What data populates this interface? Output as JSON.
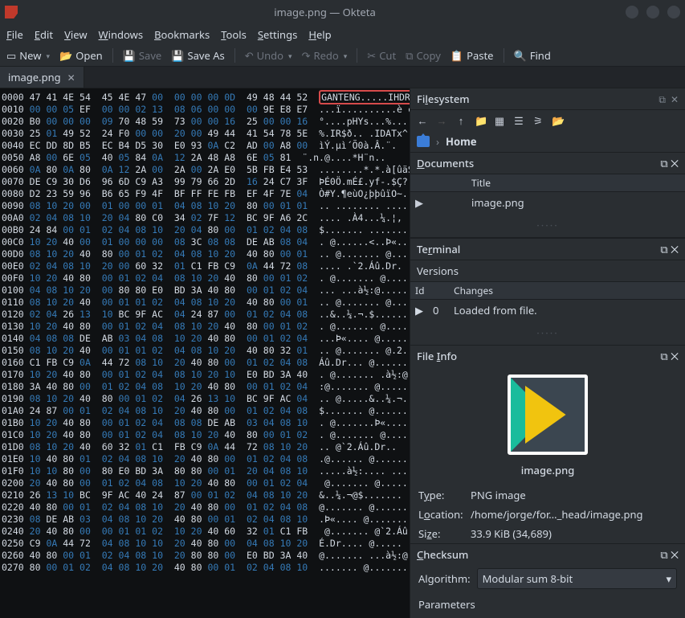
{
  "window": {
    "title": "image.png — Okteta"
  },
  "menu": {
    "file": "File",
    "edit": "Edit",
    "view": "View",
    "windows": "Windows",
    "bookmarks": "Bookmarks",
    "tools": "Tools",
    "settings": "Settings",
    "help": "Help"
  },
  "toolbar": {
    "new": "New",
    "open": "Open",
    "save": "Save",
    "saveas": "Save As",
    "undo": "Undo",
    "redo": "Redo",
    "cut": "Cut",
    "copy": "Copy",
    "paste": "Paste",
    "find": "Find"
  },
  "tab": {
    "name": "image.png"
  },
  "hex": {
    "rows": [
      {
        "off": "0000",
        "hex": "47 41 4E 54  45 4E 47 00  00 00 00 0D  49 48 44 52",
        "asc": "GANTENG.....IHDR",
        "hl": true
      },
      {
        "off": "0010",
        "hex": "00 00 05 EF  00 00 02 13  08 06 00 00  00 9E E8 E7",
        "asc": "...ï..........è ç"
      },
      {
        "off": "0020",
        "hex": "B0 00 00 00  09 70 48 59  73 00 00 16  25 00 00 16",
        "asc": "°....pHYs...%..."
      },
      {
        "off": "0030",
        "hex": "25 01 49 52  24 F0 00 00  20 00 49 44  41 54 78 5E",
        "asc": "%.IR$ð.. .IDATx^"
      },
      {
        "off": "0040",
        "hex": "EC DD 8D B5  EC B4 D5 30  E0 93 0A C2  AD 00 A8 00",
        "asc": "ìÝ.µì´Õ0à.Â­.¨."
      },
      {
        "off": "0050",
        "hex": "A8 00 6E 05  40 05 84 0A  12 2A 48 A8  6E 05 81",
        "asc": "¨.n.@....*H¨n.."
      },
      {
        "off": "0060",
        "hex": "0A 80 0A 80  0A 12 2A 00  2A 00 2A E0  5B FB E4 53",
        "asc": "........*.*.à[ûäS"
      },
      {
        "off": "0070",
        "hex": "DE C9 30 D6  96 6D C9 A3  99 79 66 2D  16 24 C7 3F",
        "asc": "ÞÉ0Ö.mÉ£.yf-.$Ç?"
      },
      {
        "off": "0080",
        "hex": "D2 23 59 96  B6 65 F9 4F  BF FF FE FB  EF 4F 7E 04",
        "asc": "Ò#Y.¶eùO¿þþûïO~."
      },
      {
        "off": "0090",
        "hex": "08 10 20 00  01 00 00 01  04 08 10 20  80 00 01 01",
        "asc": ".. ........ ...."
      },
      {
        "off": "00A0",
        "hex": "02 04 08 10  20 04 80 C0  34 02 7F 12  BC 9F A6 2C",
        "asc": ".... .À4...¼.¦,"
      },
      {
        "off": "00B0",
        "hex": "24 84 00 01  02 04 08 10  20 04 80 00  01 02 04 08",
        "asc": "$....... ......."
      },
      {
        "off": "00C0",
        "hex": "10 20 40 00  01 00 00 00  08 3C 08 08  DE AB 08 04",
        "asc": ". @......<..Þ«.."
      },
      {
        "off": "00D0",
        "hex": "08 10 20 40  80 00 01 02  04 08 10 20  40 80 00 01",
        "asc": ".. @....... @..."
      },
      {
        "off": "00E0",
        "hex": "02 04 08 10  20 00 60 32  01 C1 FB C9  0A 44 72 08",
        "asc": ".... .`2.Áû.Dr."
      },
      {
        "off": "00F0",
        "hex": "10 20 40 80  00 01 02 04  08 10 20 40  80 00 01 02",
        "asc": ". @....... @...."
      },
      {
        "off": "0100",
        "hex": "04 08 10 20  00 80 80 E0  BD 3A 40 80  00 01 02 04",
        "asc": "... ...à½:@....."
      },
      {
        "off": "0110",
        "hex": "08 10 20 40  00 01 01 02  04 08 10 20  40 80 00 01",
        "asc": ".. @....... @..."
      },
      {
        "off": "0120",
        "hex": "02 04 26 13  10 BC 9F AC  04 24 87 00  01 02 04 08",
        "asc": "..&..¼.¬.$......"
      },
      {
        "off": "0130",
        "hex": "10 20 40 80  00 01 02 04  08 10 20 40  80 00 01 02",
        "asc": ". @....... @...."
      },
      {
        "off": "0140",
        "hex": "04 08 08 DE  AB 03 04 08  10 20 40 80  00 01 02 04",
        "asc": "...Þ«.... @....."
      },
      {
        "off": "0150",
        "hex": "08 10 20 40  00 01 01 02  04 08 10 20  40 80 32 01",
        "asc": ".. @....... @.2."
      },
      {
        "off": "0160",
        "hex": "C1 FB C9 0A  44 72 08 10  20 40 80 00  01 02 04 08",
        "asc": "Áû.Dr... @......"
      },
      {
        "off": "0170",
        "hex": "10 20 40 80  00 01 02 04  08 10 20 10  E0 BD 3A 40",
        "asc": ". @....... .à½:@"
      },
      {
        "off": "0180",
        "hex": "3A 40 80 00  01 02 04 08  10 20 40 80  00 01 02 04",
        "asc": ":@....... @....."
      },
      {
        "off": "0190",
        "hex": "08 10 20 40  80 00 01 02  04 26 13 10  BC 9F AC 04",
        "asc": ".. @.....&..¼.¬."
      },
      {
        "off": "01A0",
        "hex": "24 87 00 01  02 04 08 10  20 40 80 00  01 02 04 08",
        "asc": "$....... @......"
      },
      {
        "off": "01B0",
        "hex": "10 20 40 80  00 01 02 04  08 08 DE AB  03 04 08 10",
        "asc": ". @.......Þ«...."
      },
      {
        "off": "01C0",
        "hex": "10 20 40 80  00 01 02 04  08 10 20 40  80 00 01 02",
        "asc": ". @....... @...."
      },
      {
        "off": "01D0",
        "hex": "08 10 20 40  60 32 01 C1  FB C9 0A 44  72 08 10 20",
        "asc": ".. @`2.Áû.Dr.. "
      },
      {
        "off": "01E0",
        "hex": "10 40 80 01  02 04 08 10  20 40 80 00  01 02 04 08",
        "asc": ".@...... @......"
      },
      {
        "off": "01F0",
        "hex": "10 10 80 00  80 E0 BD 3A  80 80 00 01  20 04 08 10",
        "asc": ".....à½:.... ..."
      },
      {
        "off": "0200",
        "hex": "20 40 80 00  01 02 04 08  10 20 40 80  00 01 02 04",
        "asc": " @....... @....."
      },
      {
        "off": "0210",
        "hex": "26 13 10 BC  9F AC 40 24  87 00 01 02  04 08 10 20",
        "asc": "&..¼.¬@$....... "
      },
      {
        "off": "0220",
        "hex": "40 80 00 01  02 04 08 10  20 40 80 00  01 02 04 08",
        "asc": "@....... @......"
      },
      {
        "off": "0230",
        "hex": "08 DE AB 03  04 08 10 20  40 80 00 01  02 04 08 10",
        "asc": ".Þ«.... @......."
      },
      {
        "off": "0240",
        "hex": "20 40 80 00  00 01 01 02  10 20 40 60  32 01 C1 FB",
        "asc": " @....... @`2.Áû"
      },
      {
        "off": "0250",
        "hex": "C9 0A 44 72  04 08 10 10  20 40 80 00  04 08 10 20",
        "asc": "É.Dr.... @..... "
      },
      {
        "off": "0260",
        "hex": "40 80 00 01  02 04 08 10  20 80 80 00  E0 BD 3A 40",
        "asc": "@....... ...à½:@"
      },
      {
        "off": "0270",
        "hex": "80 00 01 02  04 08 10 20  40 80 00 01  02 04 08 10",
        "asc": "....... @......."
      }
    ]
  },
  "filesystem": {
    "title": "Fi&lesystem",
    "home": "Home",
    "docs_title": "&Documents",
    "col_title": "Title",
    "item": "image.png"
  },
  "terminal": {
    "title": "Te&rminal"
  },
  "versions": {
    "title": "Versions",
    "col_id": "Id",
    "col_changes": "Changes",
    "row_id": "0",
    "row_changes": "Loaded from file."
  },
  "fileinfo": {
    "title": "File &Info",
    "name": "image.png",
    "type_k": "Type:",
    "type_v": "PNG image",
    "loc_k": "Location:",
    "loc_v": "/home/jorge/for…_head/image.png",
    "size_k": "Size:",
    "size_v": "33.9 KiB (34,689)"
  },
  "checksum": {
    "title": "&Checksum",
    "algo_k": "Algorithm:",
    "algo_v": "Modular sum 8-bit",
    "params": "Parameters"
  }
}
